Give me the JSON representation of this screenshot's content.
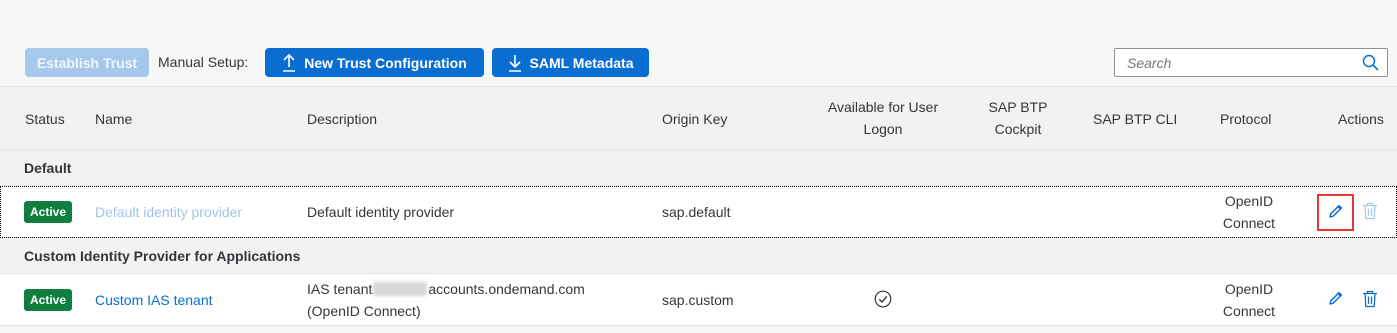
{
  "toolbar": {
    "establish_trust": "Establish Trust",
    "manual_setup_label": "Manual Setup:",
    "new_trust_configuration": "New Trust Configuration",
    "saml_metadata": "SAML Metadata",
    "search_placeholder": "Search"
  },
  "table": {
    "columns": {
      "status": "Status",
      "name": "Name",
      "description": "Description",
      "origin_key": "Origin Key",
      "available_line1": "Available for User",
      "available_line2": "Logon",
      "cockpit_line1": "SAP BTP",
      "cockpit_line2": "Cockpit",
      "cli": "SAP BTP CLI",
      "protocol": "Protocol",
      "actions": "Actions"
    },
    "groups": [
      {
        "label": "Default",
        "rows": [
          {
            "status": "Active",
            "name": "Default identity provider",
            "description_line1": "Default identity provider",
            "origin_key": "sap.default",
            "protocol_line1": "OpenID",
            "protocol_line2": "Connect"
          }
        ]
      },
      {
        "label": "Custom Identity Provider for Applications",
        "rows": [
          {
            "status": "Active",
            "name": "Custom IAS tenant",
            "description_line1_prefix": "IAS tenant",
            "description_line1_suffix": "accounts.ondemand.com",
            "description_line2": "(OpenID Connect)",
            "origin_key": "sap.custom",
            "protocol_line1": "OpenID",
            "protocol_line2": "Connect"
          }
        ]
      }
    ]
  },
  "icons": {
    "upload": "upload-icon",
    "download": "download-icon",
    "search": "search-icon",
    "edit": "pencil-icon",
    "delete": "trash-icon",
    "available_check": "check-circle-icon"
  },
  "colors": {
    "primary": "#0a6ed1",
    "status_active": "#107e3e",
    "highlight": "#e53935"
  }
}
